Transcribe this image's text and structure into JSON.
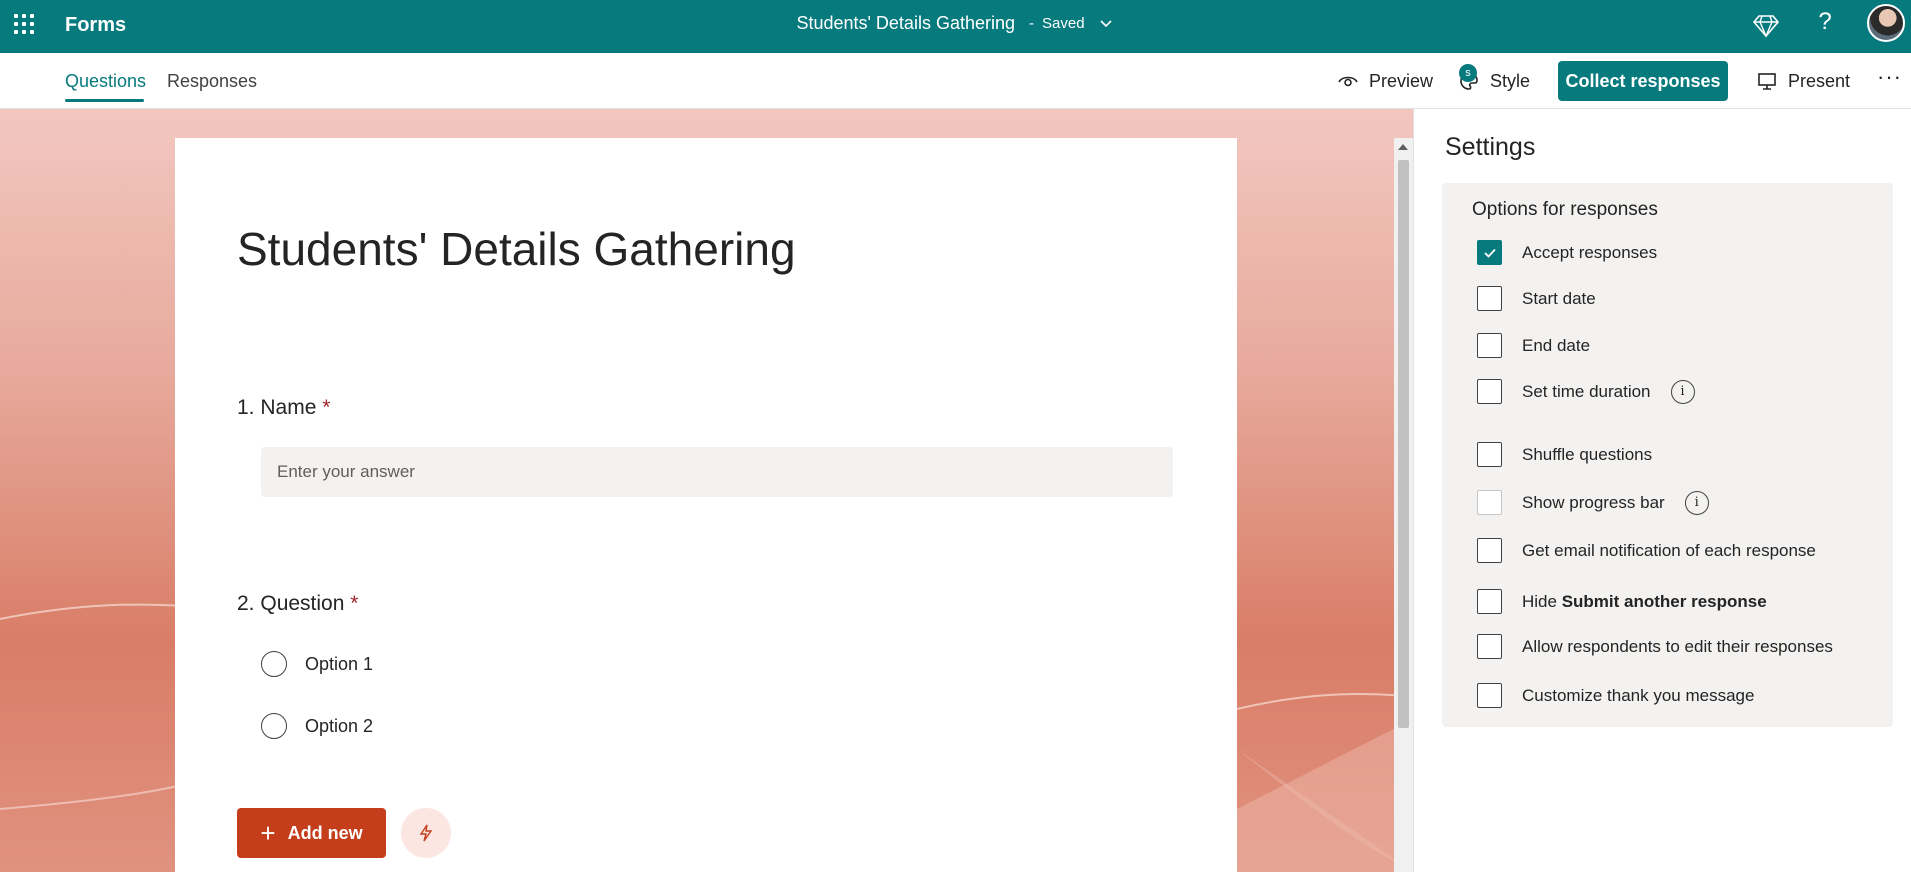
{
  "app": {
    "name": "Forms"
  },
  "document": {
    "title": "Students' Details Gathering",
    "separator": "-",
    "status": "Saved"
  },
  "tabs": [
    {
      "label": "Questions",
      "active": true
    },
    {
      "label": "Responses",
      "active": false
    }
  ],
  "toolbar": {
    "preview_label": "Preview",
    "style_label": "Style",
    "style_badge": "s",
    "collect_label": "Collect responses",
    "present_label": "Present",
    "more_label": "···"
  },
  "form": {
    "title": "Students' Details Gathering",
    "questions": [
      {
        "number": "1.",
        "label": "Name",
        "required_mark": "*",
        "placeholder": "Enter your answer"
      },
      {
        "number": "2.",
        "label": "Question",
        "required_mark": "*",
        "options": [
          "Option 1",
          "Option 2"
        ]
      }
    ],
    "add_new_label": "Add new"
  },
  "settings": {
    "title": "Settings",
    "section_title": "Options for responses",
    "options": [
      {
        "label": "Accept responses",
        "checked": true
      },
      {
        "label": "Start date",
        "checked": false
      },
      {
        "label": "End date",
        "checked": false
      },
      {
        "label": "Set time duration",
        "checked": false,
        "info": true
      },
      {
        "label": "Shuffle questions",
        "checked": false
      },
      {
        "label": "Show progress bar",
        "checked": false,
        "disabled": true,
        "info": true
      },
      {
        "label": "Get email notification of each response",
        "checked": false
      },
      {
        "label_prefix": "Hide ",
        "label_bold": "Submit another response",
        "checked": false
      },
      {
        "label": "Allow respondents to edit their responses",
        "checked": false
      },
      {
        "label": "Customize thank you message",
        "checked": false
      }
    ],
    "info_glyph": "i"
  },
  "colors": {
    "brand": "#077a7e",
    "accent_button": "#c43e1c",
    "required": "#a4262c"
  }
}
